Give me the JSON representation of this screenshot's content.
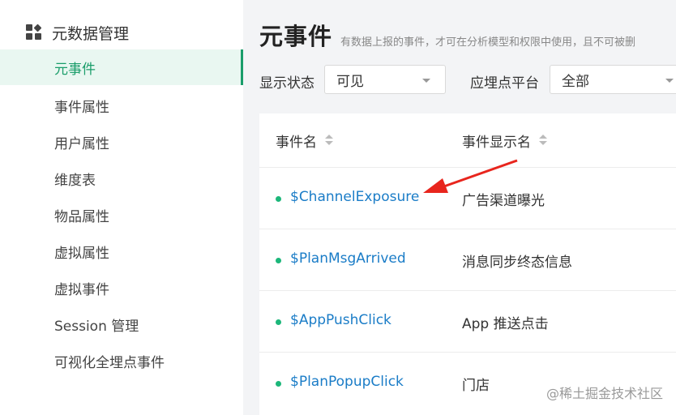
{
  "sidebar": {
    "header": "元数据管理",
    "items": [
      {
        "label": "元事件",
        "active": true
      },
      {
        "label": "事件属性"
      },
      {
        "label": "用户属性"
      },
      {
        "label": "维度表"
      },
      {
        "label": "物品属性"
      },
      {
        "label": "虚拟属性"
      },
      {
        "label": "虚拟事件"
      },
      {
        "label": "Session 管理"
      },
      {
        "label": "可视化全埋点事件"
      }
    ]
  },
  "main": {
    "title": "元事件",
    "description": "有数据上报的事件，才可在分析模型和权限中使用，且不可被删",
    "filters": {
      "status_label": "显示状态",
      "status_value": "可见",
      "platform_label": "应埋点平台",
      "platform_value": "全部"
    },
    "table": {
      "columns": [
        "事件名",
        "事件显示名"
      ],
      "rows": [
        {
          "event": "$ChannelExposure",
          "display": "广告渠道曝光"
        },
        {
          "event": "$PlanMsgArrived",
          "display": "消息同步终态信息"
        },
        {
          "event": "$AppPushClick",
          "display": "App 推送点击"
        },
        {
          "event": "$PlanPopupClick",
          "display": "门店"
        }
      ]
    }
  },
  "watermark": "@稀土掘金技术社区",
  "colors": {
    "accent": "#1a9d6a",
    "link": "#1a7cc7",
    "arrow": "#e8251d"
  }
}
